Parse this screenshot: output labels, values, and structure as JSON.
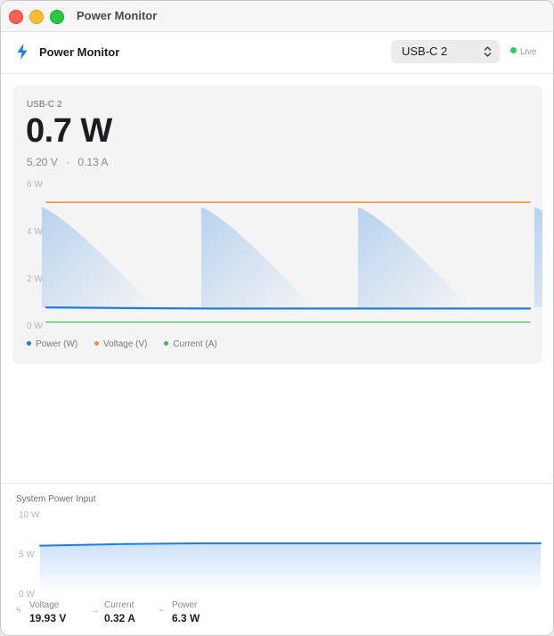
{
  "window": {
    "title": "Power Monitor"
  },
  "header": {
    "app_name": "Power Monitor",
    "selected_port": "USB-C 2",
    "live_label": "Live"
  },
  "readout": {
    "device": "USB-C 2",
    "power": "0.7 W",
    "voltage": "5.20 V",
    "current": "0.13 A",
    "separator": "·"
  },
  "colors": {
    "power": "#1c7ce0",
    "voltage": "#f0913c",
    "current": "#3fbf5a",
    "accent": "#1c7ce0"
  },
  "icons": {
    "header": "bolt-icon",
    "selector": "up-down-chevron-icon",
    "voltage": "bolt-icon",
    "current": "arrow-right-icon",
    "power": "plug-icon"
  },
  "chart_data": [
    {
      "type": "line",
      "title": "",
      "x": [
        0,
        5,
        10,
        15,
        20,
        25,
        30
      ],
      "ylim": [
        0,
        6
      ],
      "yticks": [
        "6 W",
        "4 W",
        "2 W",
        "0 W"
      ],
      "yticks_values": [
        6,
        4,
        2,
        0
      ],
      "grid": false,
      "legend": "bottom-left",
      "legend_entries": [
        "Power (W)",
        "Voltage (V)",
        "Current (A)"
      ],
      "series": [
        {
          "name": "Power (W)",
          "values": [
            0.75,
            0.72,
            0.7,
            0.7,
            0.7,
            0.7,
            0.7
          ]
        },
        {
          "name": "Voltage (V)",
          "values": [
            5.2,
            5.2,
            5.2,
            5.2,
            5.2,
            5.2,
            5.2
          ]
        },
        {
          "name": "Current (A)",
          "values": [
            0.13,
            0.13,
            0.13,
            0.13,
            0.13,
            0.13,
            0.13
          ]
        }
      ]
    },
    {
      "type": "area",
      "title": "System Power Input",
      "x": [
        0,
        5,
        10,
        15,
        20,
        25,
        30
      ],
      "ylim": [
        0,
        10
      ],
      "yticks": [
        "10 W",
        "5 W",
        "0 W"
      ],
      "yticks_values": [
        10,
        5,
        0
      ],
      "grid": false,
      "series": [
        {
          "name": "Power",
          "values": [
            6.0,
            6.2,
            6.3,
            6.3,
            6.3,
            6.3,
            6.3
          ]
        }
      ]
    }
  ],
  "system": {
    "title": "System Power Input",
    "stats": [
      {
        "label": "Voltage",
        "value": "19.93 V"
      },
      {
        "label": "Current",
        "value": "0.32 A"
      },
      {
        "label": "Power",
        "value": "6.3 W"
      }
    ]
  }
}
